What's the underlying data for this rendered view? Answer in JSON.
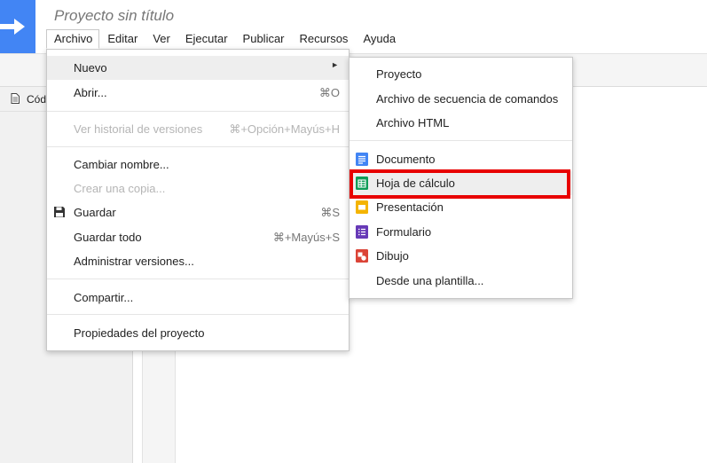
{
  "header": {
    "project_title": "Proyecto sin título",
    "menus": [
      "Archivo",
      "Editar",
      "Ver",
      "Ejecutar",
      "Publicar",
      "Recursos",
      "Ayuda"
    ],
    "active_menu": "Archivo",
    "brand_color": "#4285f4"
  },
  "sidebar": {
    "file_label": "Cód"
  },
  "file_menu": {
    "new": {
      "label": "Nuevo",
      "arrow": "►"
    },
    "open": {
      "label": "Abrir...",
      "shortcut": "⌘O"
    },
    "history": {
      "label": "Ver historial de versiones",
      "shortcut": "⌘+Opción+Mayús+H",
      "disabled": true
    },
    "rename": {
      "label": "Cambiar nombre..."
    },
    "copy": {
      "label": "Crear una copia...",
      "disabled": true
    },
    "save": {
      "label": "Guardar",
      "shortcut": "⌘S",
      "icon": "floppy-disk-icon"
    },
    "save_all": {
      "label": "Guardar todo",
      "shortcut": "⌘+Mayús+S"
    },
    "manage": {
      "label": "Administrar versiones..."
    },
    "share": {
      "label": "Compartir..."
    },
    "properties": {
      "label": "Propiedades del proyecto"
    }
  },
  "new_submenu": {
    "project": {
      "label": "Proyecto"
    },
    "script_file": {
      "label": "Archivo de secuencia de comandos"
    },
    "html_file": {
      "label": "Archivo HTML"
    },
    "document": {
      "label": "Documento",
      "icon": "docs-icon",
      "color": "#4285f4"
    },
    "spreadsheet": {
      "label": "Hoja de cálculo",
      "icon": "sheets-icon",
      "color": "#0f9d58",
      "highlighted": true
    },
    "presentation": {
      "label": "Presentación",
      "icon": "slides-icon",
      "color": "#f4b400"
    },
    "form": {
      "label": "Formulario",
      "icon": "forms-icon",
      "color": "#673ab7"
    },
    "drawing": {
      "label": "Dibujo",
      "icon": "drawings-icon",
      "color": "#db4437"
    },
    "template": {
      "label": "Desde una plantilla..."
    },
    "highlight_color": "#e80000"
  }
}
